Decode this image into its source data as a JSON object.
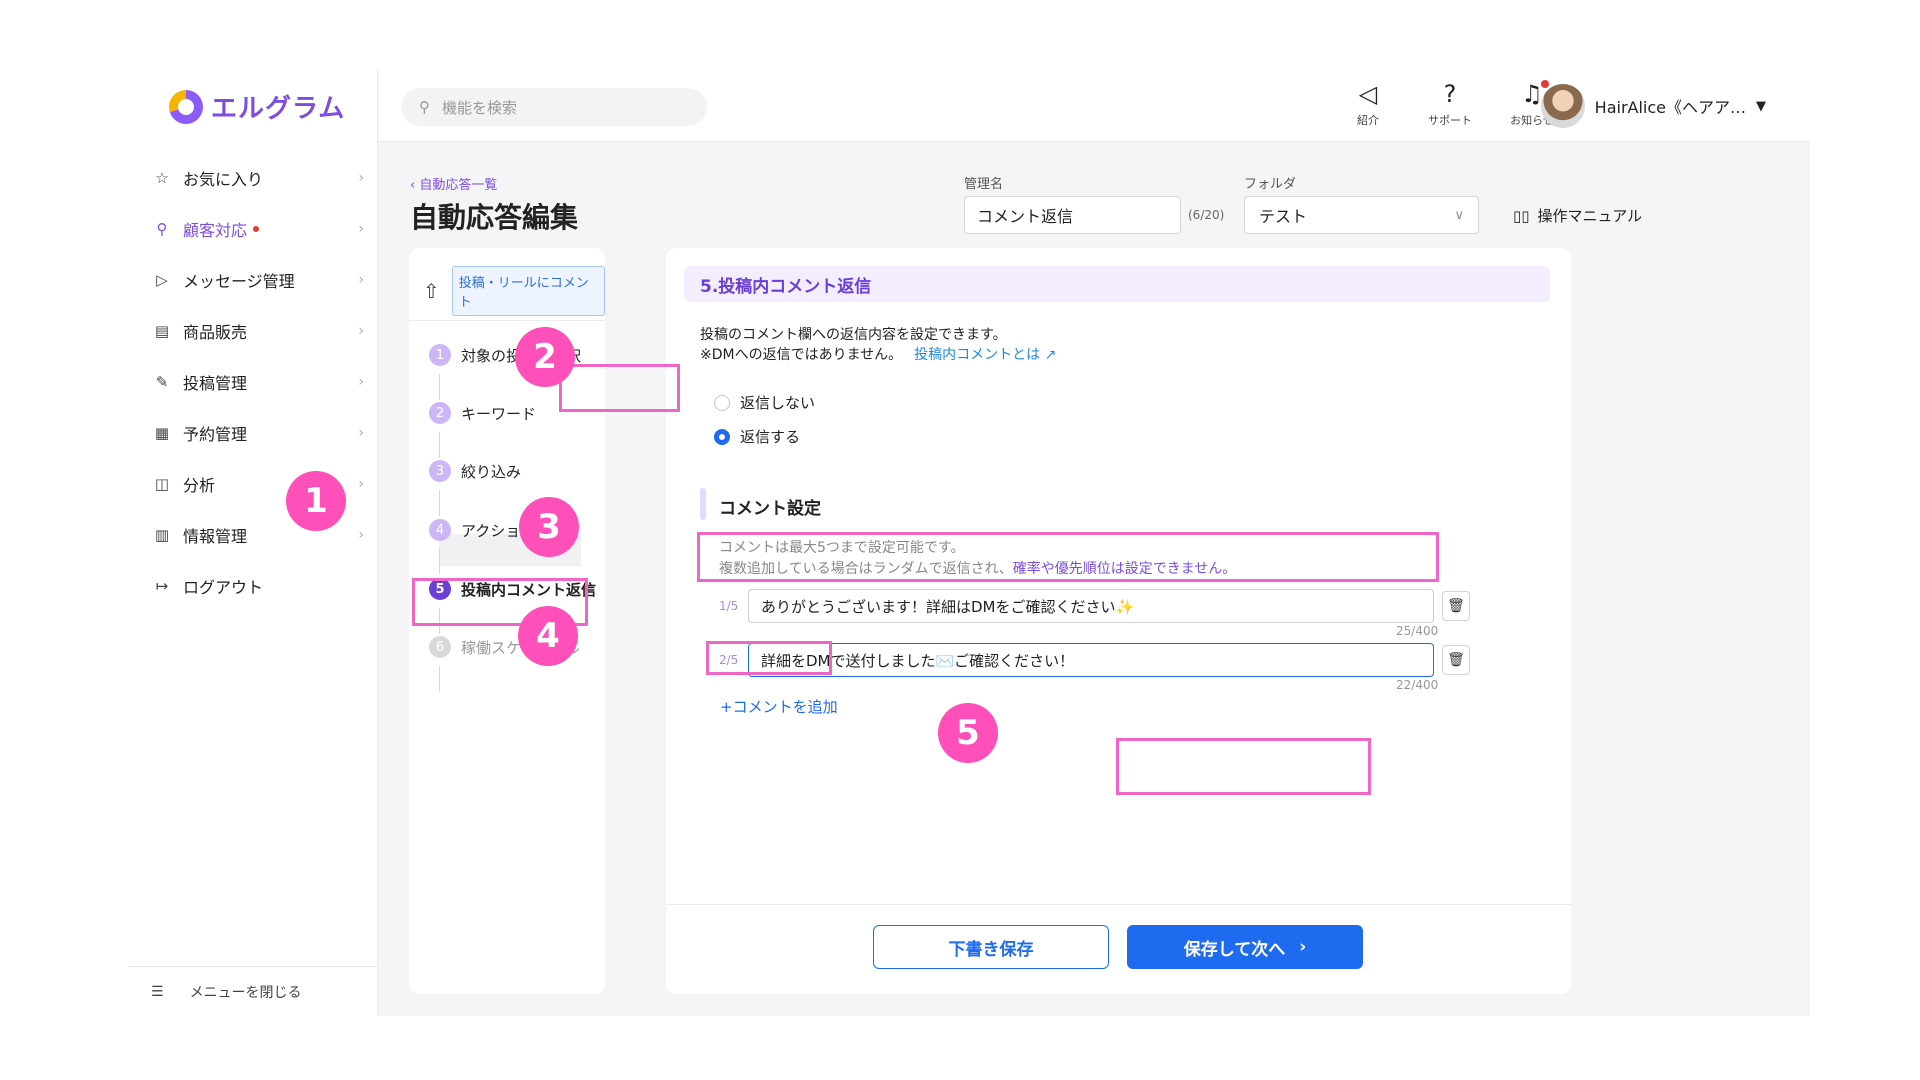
{
  "app": {
    "logo_text": "エルグラム"
  },
  "search": {
    "placeholder": "機能を検索"
  },
  "header_icons": [
    {
      "label": "紹介",
      "icon": "megaphone-icon"
    },
    {
      "label": "サポート",
      "icon": "help-icon"
    },
    {
      "label": "お知らせ",
      "icon": "bell-icon"
    }
  ],
  "user": {
    "name": "HairAlice《ヘアア…"
  },
  "sidebar": {
    "items": [
      {
        "label": "お気に入り",
        "icon": "star-icon"
      },
      {
        "label": "顧客対応",
        "icon": "person-icon"
      },
      {
        "label": "メッセージ管理",
        "icon": "send-icon"
      },
      {
        "label": "商品販売",
        "icon": "shop-icon"
      },
      {
        "label": "投稿管理",
        "icon": "edit-icon"
      },
      {
        "label": "予約管理",
        "icon": "calendar-icon"
      },
      {
        "label": "分析",
        "icon": "analytics-icon"
      },
      {
        "label": "情報管理",
        "icon": "chart-icon"
      },
      {
        "label": "ログアウト",
        "icon": "logout-icon"
      }
    ],
    "close_label": "メニューを閉じる"
  },
  "page": {
    "back_label": "自動応答一覧",
    "title": "自動応答編集",
    "mgmt_label": "管理名",
    "mgmt_value": "コメント返信",
    "mgmt_count": "(6/20)",
    "folder_label": "フォルダ",
    "folder_value": "テスト",
    "manual_label": "操作マニュアル"
  },
  "steps": {
    "trigger_badge": "投稿・リールにコメント",
    "items": [
      {
        "num": "1",
        "label": "対象の投稿を選択"
      },
      {
        "num": "2",
        "label": "キーワード"
      },
      {
        "num": "3",
        "label": "絞り込み"
      },
      {
        "num": "4",
        "label": "アクション設定"
      },
      {
        "num": "5",
        "label": "投稿内コメント返信"
      },
      {
        "num": "6",
        "label": "稼働スケジュール"
      }
    ]
  },
  "main": {
    "section_title": "5.投稿内コメント返信",
    "desc1": "投稿のコメント欄への返信内容を設定できます。",
    "desc2": "※DMへの返信ではありません。",
    "desc_link": "投稿内コメントとは",
    "radio_no": "返信しない",
    "radio_yes": "返信する",
    "comment_section_title": "コメント設定",
    "note1": "コメントは最大5つまで設定可能です。",
    "note2": "複数追加している場合はランダムで返信され、",
    "note2_emphasis": "確率や優先順位は設定できません。",
    "comments": [
      {
        "index": "1/5",
        "text": "ありがとうございます！詳細はDMをご確認ください✨",
        "counter": "25/400"
      },
      {
        "index": "2/5",
        "text": "詳細をDMで送付しました✉️ご確認ください！",
        "counter": "22/400"
      }
    ],
    "add_comment_label": "+コメントを追加",
    "draft_button": "下書き保存",
    "next_button": "保存して次へ"
  },
  "markers": [
    "1",
    "2",
    "3",
    "4",
    "5"
  ],
  "colors": {
    "accent": "#7c4ddf",
    "primary_button": "#1e6bf0",
    "marker": "#ff4fb8",
    "highlight_border": "#f066c6"
  }
}
